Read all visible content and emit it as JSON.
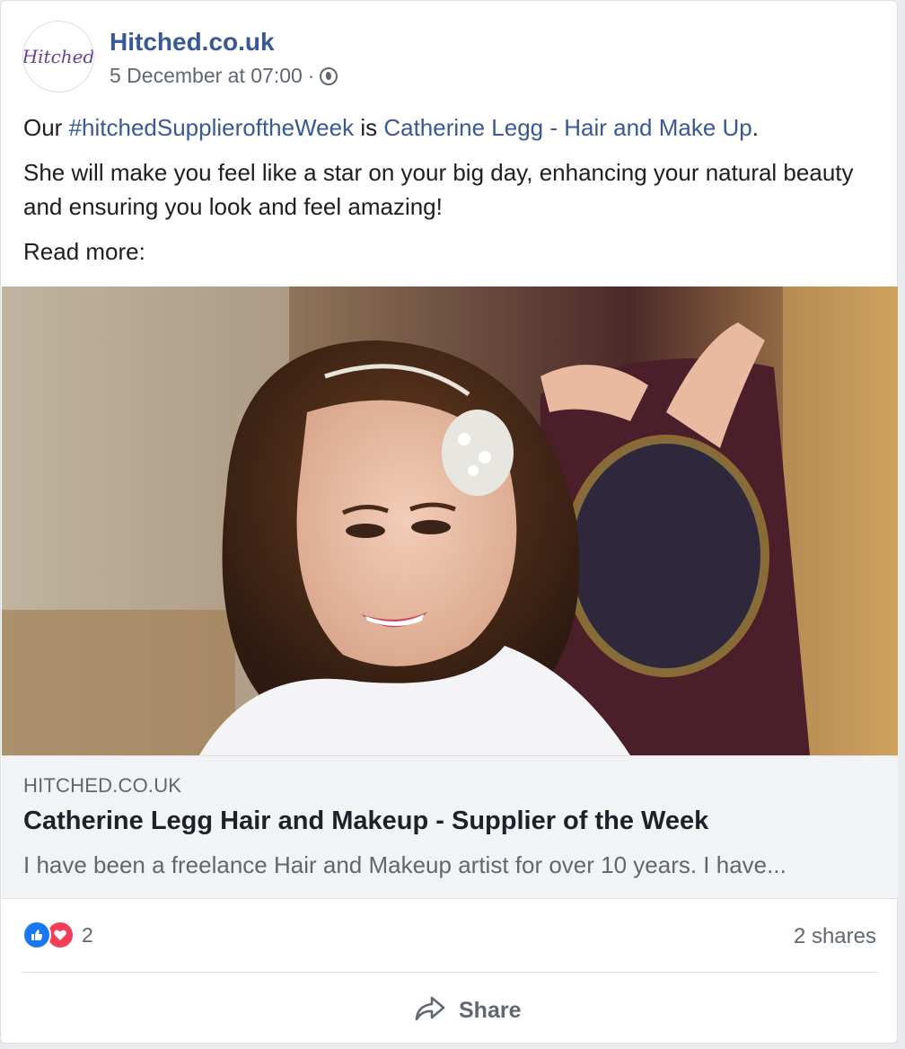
{
  "post": {
    "page_name": "Hitched.co.uk",
    "avatar_text": "Hitched",
    "date": "5 December at 07:00",
    "separator": "·",
    "text": {
      "line1_prefix": "Our ",
      "hashtag": "#hitchedSupplieroftheWeek",
      "line1_mid": " is ",
      "mention": "Catherine Legg - Hair and Make Up",
      "line1_end": ".",
      "paragraph2": "She will make you feel like a star on your big day, enhancing your natural beauty and ensuring you look and feel amazing!",
      "paragraph3": "Read more:"
    }
  },
  "link_preview": {
    "domain": "HITCHED.CO.UK",
    "title": "Catherine Legg Hair and Makeup - Supplier of the Week",
    "description": "I have been a freelance Hair and Makeup artist for over 10 years. I have..."
  },
  "engagement": {
    "reaction_count": "2",
    "reaction_icons": [
      "like-icon",
      "love-icon"
    ],
    "shares": "2 shares"
  },
  "actions": {
    "share_label": "Share"
  },
  "colors": {
    "link": "#385898",
    "like": "#1877f2",
    "love": "#f33e58",
    "muted": "#606770"
  }
}
